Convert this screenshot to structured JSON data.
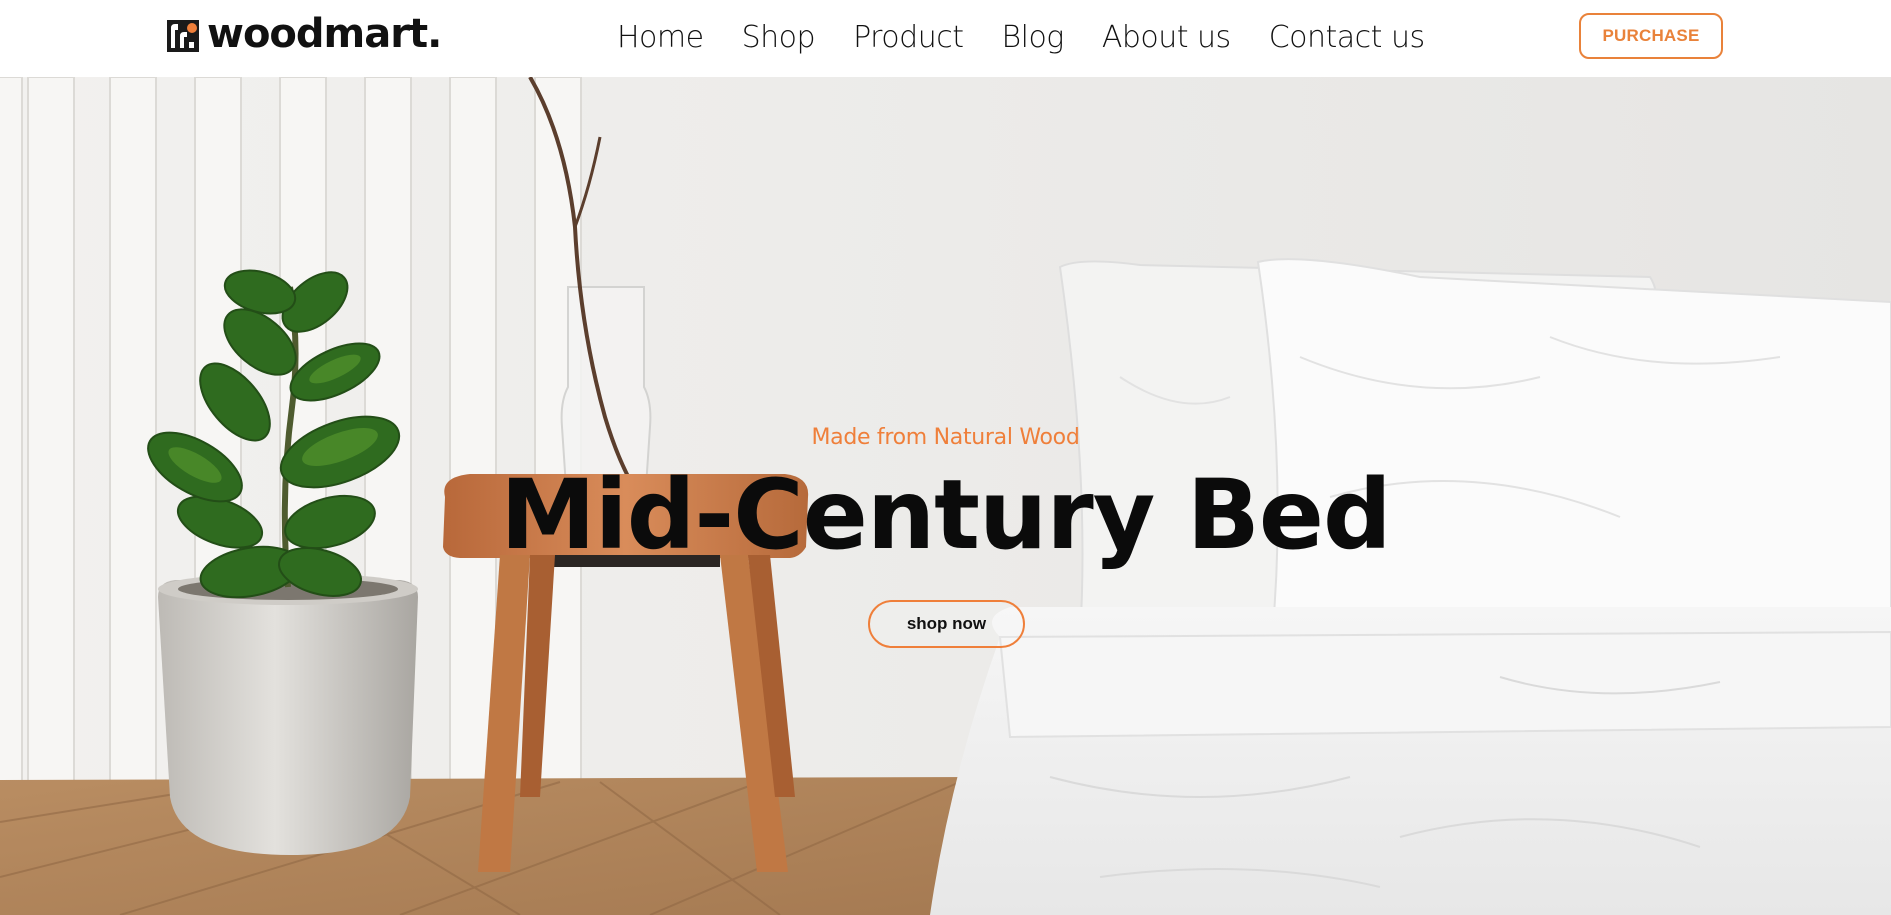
{
  "brand": {
    "name": "woodmart.",
    "accent": "#ef7f3a"
  },
  "nav": {
    "items": [
      {
        "label": "Home"
      },
      {
        "label": "Shop"
      },
      {
        "label": "Product"
      },
      {
        "label": "Blog"
      },
      {
        "label": "About us"
      },
      {
        "label": "Contact us"
      }
    ]
  },
  "header": {
    "purchase_label": "PURCHASE"
  },
  "hero": {
    "subtitle": "Made from Natural Wood",
    "title": "Mid-Century Bed",
    "cta_label": "shop now"
  },
  "icons": {
    "logo": "woodmart-logo-icon"
  }
}
